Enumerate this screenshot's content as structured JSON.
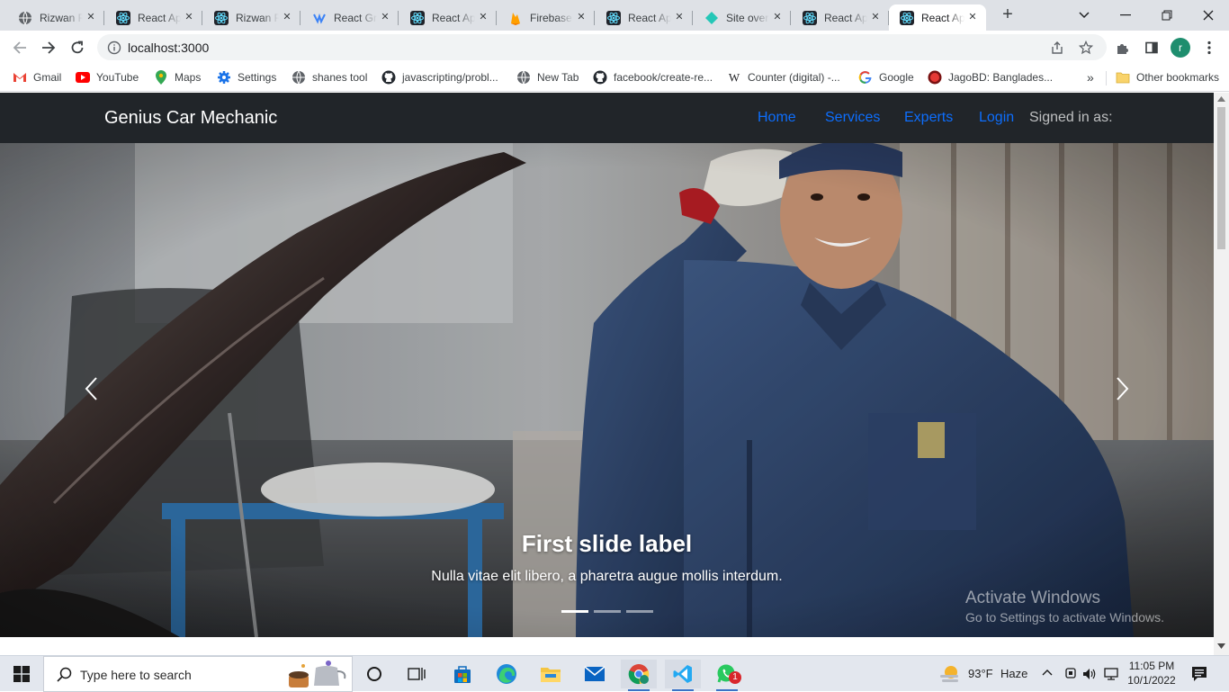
{
  "browser": {
    "tabs": [
      {
        "title": "Rizwan R",
        "icon": "globe-icon"
      },
      {
        "title": "React Ap",
        "icon": "react-icon"
      },
      {
        "title": "Rizwan R",
        "icon": "react-icon"
      },
      {
        "title": "React Gr",
        "icon": "grid-icon"
      },
      {
        "title": "React Ap",
        "icon": "react-icon"
      },
      {
        "title": "Firebase",
        "icon": "firebase-icon"
      },
      {
        "title": "React Ap",
        "icon": "react-icon"
      },
      {
        "title": "Site over",
        "icon": "netlify-icon"
      },
      {
        "title": "React Ap",
        "icon": "react-icon"
      },
      {
        "title": "React Ap",
        "icon": "react-icon",
        "active": true
      }
    ],
    "url": "localhost:3000",
    "profile_initial": "r",
    "bookmarks": [
      {
        "label": "Gmail",
        "icon": "gmail-icon"
      },
      {
        "label": "YouTube",
        "icon": "youtube-icon"
      },
      {
        "label": "Maps",
        "icon": "maps-icon"
      },
      {
        "label": "Settings",
        "icon": "gear-icon"
      },
      {
        "label": "shanes tool",
        "icon": "globe-icon"
      },
      {
        "label": "javascripting/probl...",
        "icon": "github-icon"
      },
      {
        "label": "New Tab",
        "icon": "globe-icon"
      },
      {
        "label": "facebook/create-re...",
        "icon": "github-icon"
      },
      {
        "label": "Counter (digital) -...",
        "icon": "wikipedia-icon"
      },
      {
        "label": "Google",
        "icon": "google-icon"
      },
      {
        "label": "JagoBD: Banglades...",
        "icon": "jagobd-icon"
      }
    ],
    "more_bookmarks": "»",
    "other_bookmarks": "Other bookmarks"
  },
  "site": {
    "brand": "Genius Car Mechanic",
    "nav": [
      "Home",
      "Services",
      "Experts",
      "Login"
    ],
    "signed_in": "Signed in as:",
    "carousel": {
      "title": "First slide label",
      "text": "Nulla vitae elit libero, a pharetra augue mollis interdum.",
      "slide_count": 3,
      "active_slide": 1
    }
  },
  "watermark": {
    "title": "Activate Windows",
    "subtitle": "Go to Settings to activate Windows."
  },
  "taskbar": {
    "search_placeholder": "Type here to search",
    "weather_temp": "93°F",
    "weather_text": "Haze",
    "time": "11:05 PM",
    "date": "10/1/2022",
    "whatsapp_badge": "1"
  },
  "colors": {
    "navbar_bg": "#212529",
    "nav_link": "#0d6efd",
    "tabbar_bg": "#dee1e6",
    "taskbar_bg": "#e3e7ee"
  }
}
